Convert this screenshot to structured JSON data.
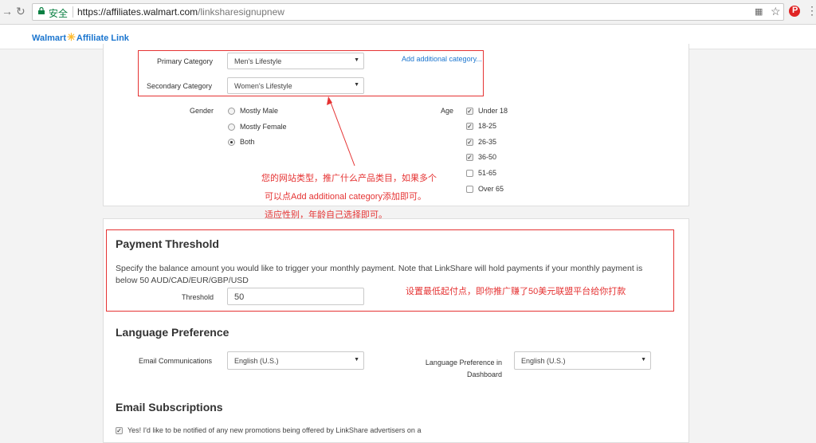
{
  "browser": {
    "secure_label": "安全",
    "url_host": "https://affiliates.walmart.com",
    "url_path": "/linksharesignupnew"
  },
  "site": {
    "brand": "Walmart",
    "spark": "✳",
    "product": "Affiliate Link"
  },
  "categories": {
    "primary_label": "Primary Category",
    "primary_value": "Men's Lifestyle",
    "secondary_label": "Secondary Category",
    "secondary_value": "Women's Lifestyle",
    "add_link": "Add additional category..."
  },
  "gender": {
    "label": "Gender",
    "options": [
      {
        "label": "Mostly Male",
        "selected": false
      },
      {
        "label": "Mostly Female",
        "selected": false
      },
      {
        "label": "Both",
        "selected": true
      }
    ]
  },
  "age": {
    "label": "Age",
    "options": [
      {
        "label": "Under 18",
        "checked": true
      },
      {
        "label": "18-25",
        "checked": true
      },
      {
        "label": "26-35",
        "checked": true
      },
      {
        "label": "36-50",
        "checked": true
      },
      {
        "label": "51-65",
        "checked": false
      },
      {
        "label": "Over 65",
        "checked": false
      }
    ]
  },
  "annotation1": {
    "lines": [
      "您的网站类型，推广什么产品类目，如果多个",
      "可以点Add additional category添加即可。",
      "适应性别，年龄自己选择即可。"
    ]
  },
  "payment": {
    "title": "Payment Threshold",
    "description_line1": "Specify the balance amount you would like to trigger your monthly payment. Note that LinkShare will hold payments if your monthly payment is",
    "description_line2": "below 50 AUD/CAD/EUR/GBP/USD",
    "threshold_label": "Threshold",
    "threshold_value": "50",
    "note": "设置最低起付点，即你推广赚了50美元联盟平台给你打款"
  },
  "language": {
    "title": "Language Preference",
    "email_label": "Email Communications",
    "email_value": "English (U.S.)",
    "dashboard_label_line1": "Language Preference in",
    "dashboard_label_line2": "Dashboard",
    "dashboard_value": "English (U.S.)"
  },
  "subscriptions": {
    "title": "Email Subscriptions",
    "first_option": "Yes! I'd like to be notified of any new promotions being offered by LinkShare advertisers on a"
  },
  "colors": {
    "annotation_red": "#e53333",
    "link_blue": "#1a75cf",
    "walmart_yellow": "#fdbb30"
  }
}
